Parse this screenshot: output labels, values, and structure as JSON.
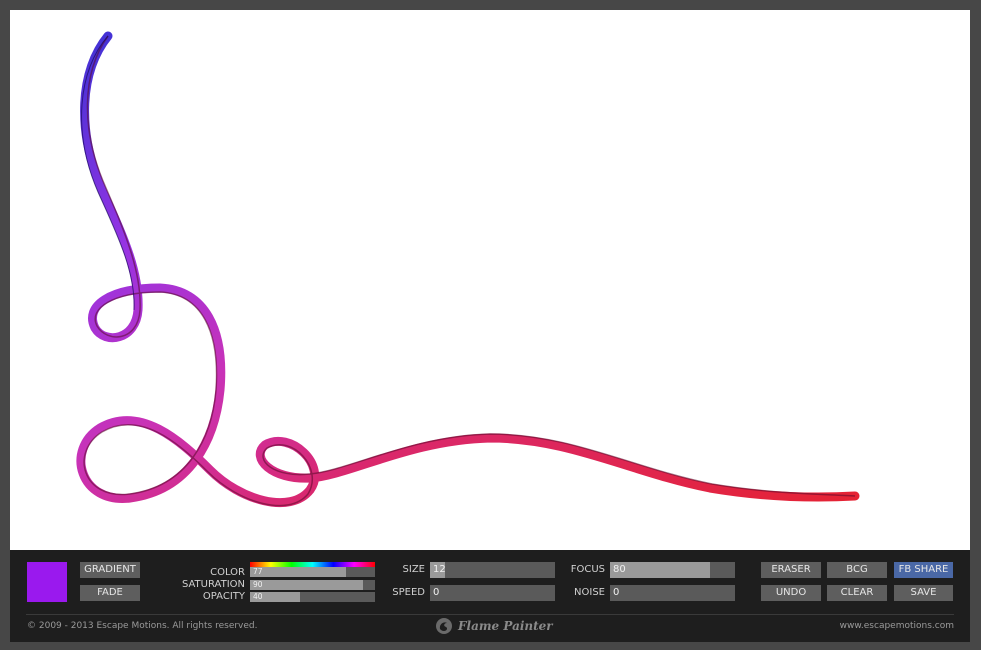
{
  "canvas": {
    "stroke_colors": [
      "#3a1ad6",
      "#8a1de0",
      "#c21bb0",
      "#d6105a",
      "#e20a1c"
    ]
  },
  "color_swatch": {
    "color": "#9a19ee"
  },
  "buttons": {
    "gradient": "GRADIENT",
    "fade": "FADE",
    "eraser": "ERASER",
    "bcg": "BCG",
    "fb_share": "FB SHARE",
    "undo": "UNDO",
    "clear": "CLEAR",
    "save": "SAVE"
  },
  "sliders": {
    "color": {
      "label": "COLOR",
      "value": "77",
      "level": 0.77
    },
    "saturation": {
      "label": "SATURATION",
      "value": "90",
      "level": 0.9
    },
    "opacity": {
      "label": "OPACITY",
      "value": "40",
      "level": 0.4
    },
    "size": {
      "label": "SIZE",
      "value": "12",
      "level": 0.12
    },
    "speed": {
      "label": "SPEED",
      "value": "0",
      "level": 0
    },
    "focus": {
      "label": "FOCUS",
      "value": "80",
      "level": 0.8
    },
    "noise": {
      "label": "NOISE",
      "value": "0",
      "level": 0
    }
  },
  "footer": {
    "copyright": "© 2009 - 2013 Escape Motions. All rights reserved.",
    "brand": "Flame Painter",
    "url": "www.escapemotions.com"
  },
  "icons": {
    "logo": "flame-swirl-logo-icon"
  }
}
